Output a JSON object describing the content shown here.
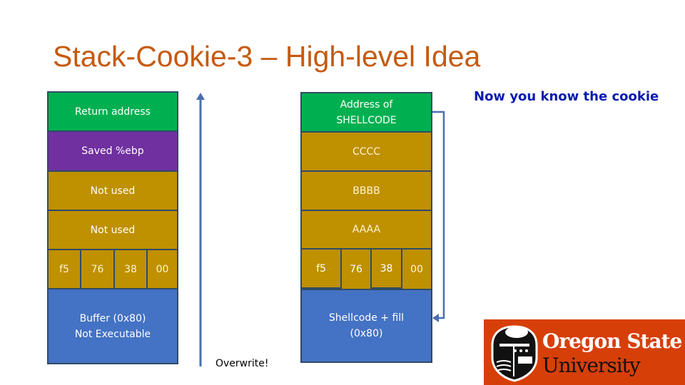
{
  "slide": {
    "title": "Stack-Cookie-3 – High-level Idea",
    "note": "Now you know the cookie",
    "overwrite_label": "Overwrite!"
  },
  "left_stack": {
    "return_address": "Return address",
    "saved_ebp": "Saved %ebp",
    "not_used_1": "Not used",
    "not_used_2": "Not used",
    "cookie_bytes": [
      "f5",
      "76",
      "38",
      "00"
    ],
    "buffer_line1": "Buffer (0x80)",
    "buffer_line2": "Not Executable"
  },
  "right_stack": {
    "return_line1": "Address of",
    "return_line2": "SHELLCODE",
    "cccc": "CCCC",
    "bbbb": "BBBB",
    "aaaa": "AAAA",
    "cookie_bytes": [
      "f5",
      "76",
      "38",
      "00"
    ],
    "buffer_line1": "Shellcode + fill",
    "buffer_line2": "(0x80)"
  },
  "logo": {
    "line1": "Oregon State",
    "line2": "University"
  },
  "colors": {
    "title": "#c55a11",
    "note": "#0a1bb0",
    "return_slot": "#00b050",
    "saved_ebp": "#7030a0",
    "filler": "#bf9000",
    "buffer": "#4472c4",
    "arrow": "#4a6fb0",
    "logo_bg": "#d73f09"
  }
}
